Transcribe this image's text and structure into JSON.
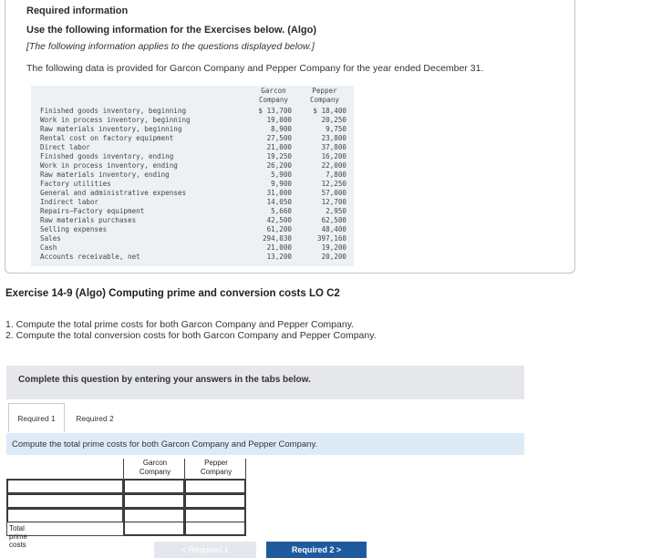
{
  "info": {
    "title": "Required information",
    "subtitle": "Use the following information for the Exercises below. (Algo)",
    "note": "[The following information applies to the questions displayed below.]",
    "intro": "The following data is provided for Garcon Company and Pepper Company for the year ended December 31."
  },
  "data_table": {
    "headers": [
      "Garcon\nCompany",
      "Pepper\nCompany"
    ],
    "rows": [
      {
        "label": "Finished goods inventory, beginning",
        "garcon": "$ 13,700",
        "pepper": "$ 18,400"
      },
      {
        "label": "Work in process inventory, beginning",
        "garcon": "19,000",
        "pepper": "20,250"
      },
      {
        "label": "Raw materials inventory, beginning",
        "garcon": "8,900",
        "pepper": "9,750"
      },
      {
        "label": "Rental cost on factory equipment",
        "garcon": "27,500",
        "pepper": "23,800"
      },
      {
        "label": "Direct labor",
        "garcon": "21,000",
        "pepper": "37,800"
      },
      {
        "label": "Finished goods inventory, ending",
        "garcon": "19,250",
        "pepper": "16,200"
      },
      {
        "label": "Work in process inventory, ending",
        "garcon": "26,200",
        "pepper": "22,000"
      },
      {
        "label": "Raw materials inventory, ending",
        "garcon": "5,900",
        "pepper": "7,800"
      },
      {
        "label": "Factory utilities",
        "garcon": "9,900",
        "pepper": "12,250"
      },
      {
        "label": "General and administrative expenses",
        "garcon": "31,000",
        "pepper": "57,000"
      },
      {
        "label": "Indirect labor",
        "garcon": "14,050",
        "pepper": "12,700"
      },
      {
        "label": "Repairs—Factory equipment",
        "garcon": "5,660",
        "pepper": "2,950"
      },
      {
        "label": "Raw materials purchases",
        "garcon": "42,500",
        "pepper": "62,500"
      },
      {
        "label": "Selling expenses",
        "garcon": "61,200",
        "pepper": "48,400"
      },
      {
        "label": "Sales",
        "garcon": "294,030",
        "pepper": "397,160"
      },
      {
        "label": "Cash",
        "garcon": "21,000",
        "pepper": "19,200"
      },
      {
        "label": "Accounts receivable, net",
        "garcon": "13,200",
        "pepper": "20,200"
      }
    ]
  },
  "exercise": {
    "title": "Exercise 14-9 (Algo) Computing prime and conversion costs LO C2",
    "q1": "1. Compute the total prime costs for both Garcon Company and Pepper Company.",
    "q2": "2. Compute the total conversion costs for both Garcon Company and Pepper Company."
  },
  "banner": "Complete this question by entering your answers in the tabs below.",
  "tabs": [
    "Required 1",
    "Required 2"
  ],
  "instruction": "Compute the total prime costs for both Garcon Company and Pepper Company.",
  "answer_table": {
    "col1": "Garcon\nCompany",
    "col2": "Pepper\nCompany",
    "total_label": "Total prime costs"
  },
  "nav": {
    "prev": "< Required 1",
    "next": "Required 2  >"
  }
}
